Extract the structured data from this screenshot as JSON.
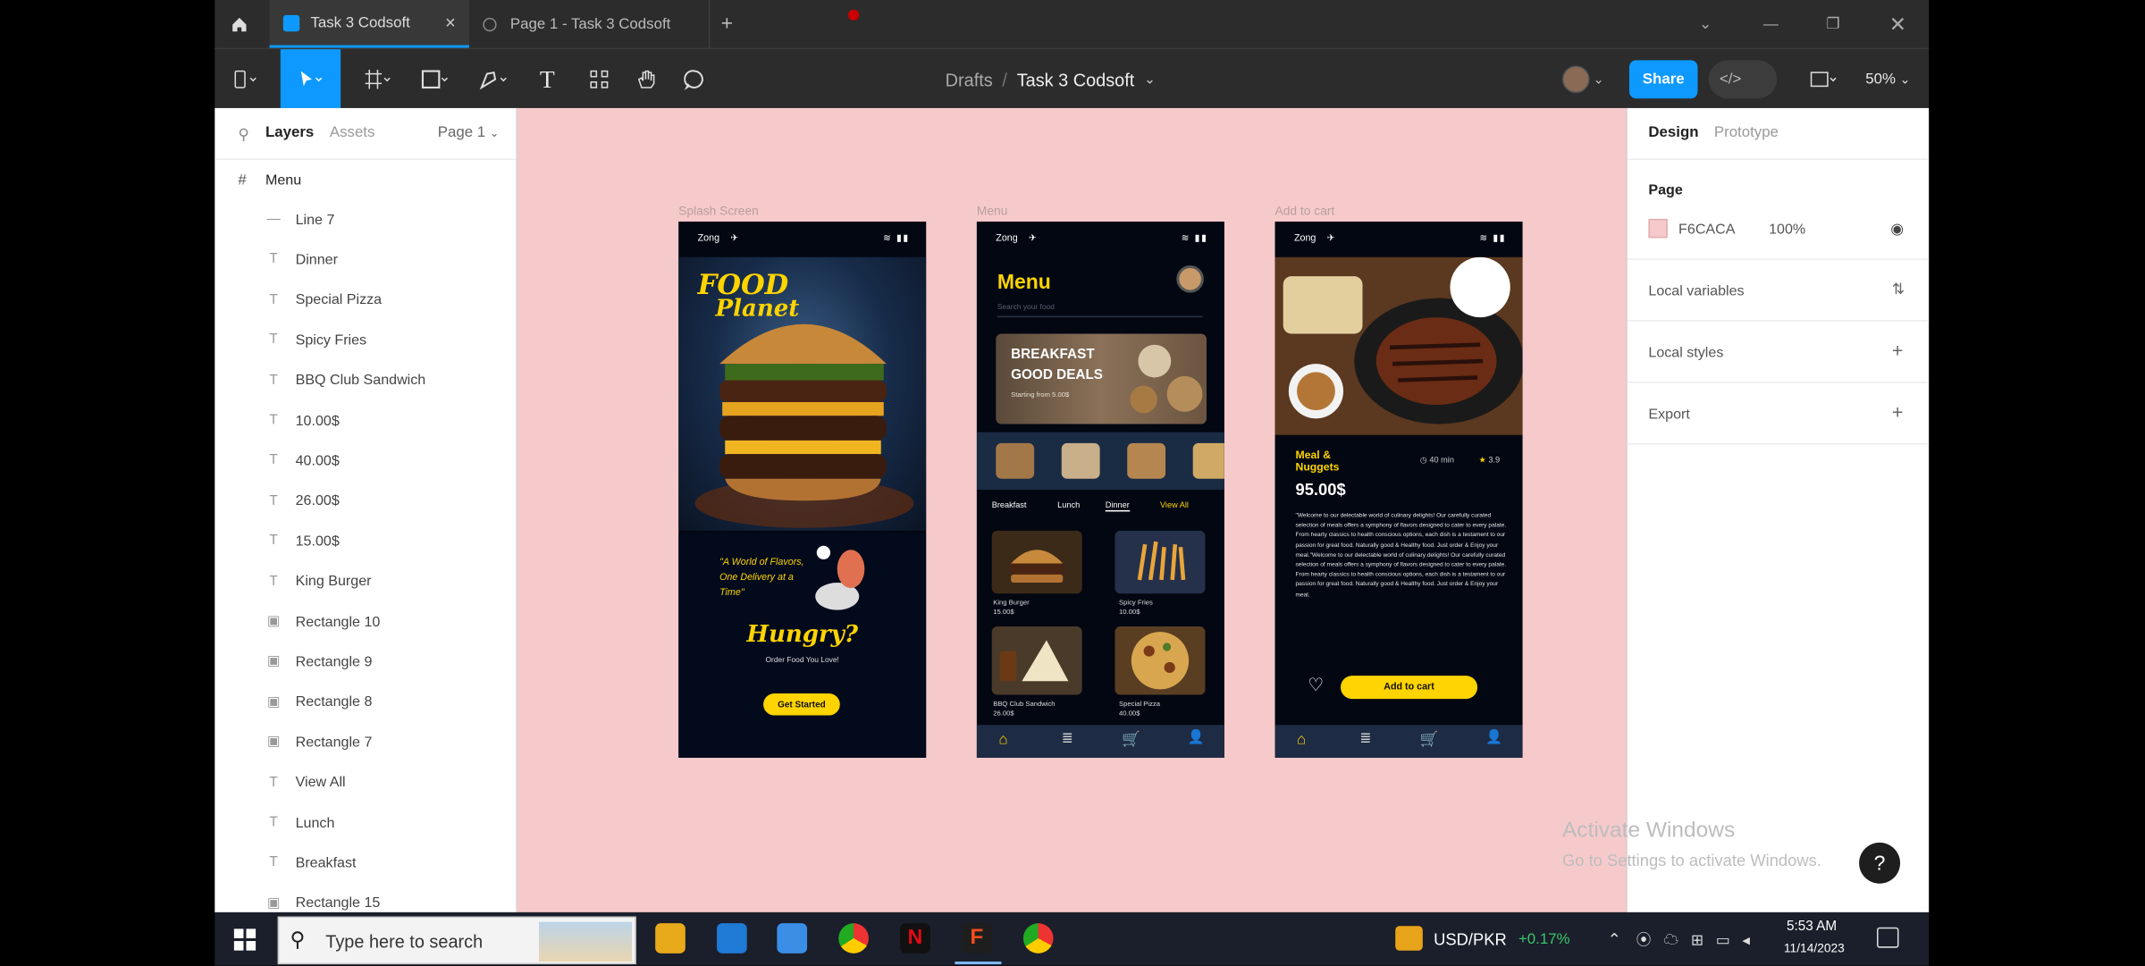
{
  "tabs": {
    "active": "Task 3 Codsoft",
    "second": "Page 1 - Task 3 Codsoft",
    "add": "+"
  },
  "toolbar": {
    "breadcrumb_root": "Drafts",
    "breadcrumb_sep": "/",
    "file_name": "Task 3 Codsoft",
    "share": "Share",
    "zoom": "50%"
  },
  "left_panel": {
    "tab_layers": "Layers",
    "tab_assets": "Assets",
    "page": "Page 1",
    "frame": "Menu",
    "layers": [
      {
        "icon": "line-icon",
        "label": "Line 7"
      },
      {
        "icon": "text-icon",
        "label": "Dinner"
      },
      {
        "icon": "text-icon",
        "label": "Special Pizza"
      },
      {
        "icon": "text-icon",
        "label": "Spicy Fries"
      },
      {
        "icon": "text-icon",
        "label": "BBQ Club Sandwich"
      },
      {
        "icon": "text-icon",
        "label": "10.00$"
      },
      {
        "icon": "text-icon",
        "label": "40.00$"
      },
      {
        "icon": "text-icon",
        "label": "26.00$"
      },
      {
        "icon": "text-icon",
        "label": "15.00$"
      },
      {
        "icon": "text-icon",
        "label": "King Burger"
      },
      {
        "icon": "image-icon",
        "label": "Rectangle 10"
      },
      {
        "icon": "image-icon",
        "label": "Rectangle 9"
      },
      {
        "icon": "image-icon",
        "label": "Rectangle 8"
      },
      {
        "icon": "image-icon",
        "label": "Rectangle 7"
      },
      {
        "icon": "text-icon",
        "label": "View All"
      },
      {
        "icon": "text-icon",
        "label": "Lunch"
      },
      {
        "icon": "text-icon",
        "label": "Breakfast"
      },
      {
        "icon": "image-icon",
        "label": "Rectangle 15"
      }
    ]
  },
  "right_panel": {
    "tab_design": "Design",
    "tab_prototype": "Prototype",
    "page_label": "Page",
    "page_color": "F6CACA",
    "page_opacity": "100%",
    "local_variables": "Local variables",
    "local_styles": "Local styles",
    "export": "Export"
  },
  "canvas": {
    "bg_color": "#f6cacb",
    "frame_labels": {
      "splash": "Splash Screen",
      "menu": "Menu",
      "cart": "Add to cart"
    }
  },
  "status": {
    "carrier": "Zong"
  },
  "splash": {
    "title_1": "FOOD",
    "title_2": "Planet",
    "quote": "\"A World of Flavors, One Delivery at a Time\"",
    "hungry": "Hungry?",
    "sub": "Order Food You Love!",
    "cta": "Get Started"
  },
  "menu": {
    "title": "Menu",
    "search": "Search your food",
    "banner_1": "BREAKFAST",
    "banner_2": "GOOD DEALS",
    "banner_sub": "Starting from 5.00$",
    "cats": {
      "breakfast": "Breakfast",
      "lunch": "Lunch",
      "dinner": "Dinner",
      "view_all": "View All"
    },
    "items": [
      {
        "name": "King Burger",
        "price": "15.00$"
      },
      {
        "name": "Spicy Fries",
        "price": "10.00$"
      },
      {
        "name": "BBQ Club Sandwich",
        "price": "26.00$"
      },
      {
        "name": "Special Pizza",
        "price": "40.00$"
      }
    ]
  },
  "cart": {
    "title_1": "Meal &",
    "title_2": "Nuggets",
    "price": "95.00$",
    "time": "40 min",
    "rating": "3.9",
    "desc": "\"Welcome to our delectable world of culinary delights! Our carefully curated selection of meals offers a symphony of flavors designed to cater to every palate. From hearty classics to health conscious options, each dish is a testament to our passion for great food. Naturally good & Healthy food. Just order & Enjoy your meal.\"Welcome to our delectable world of culinary delights! Our carefully curated selection of meals offers a symphony of flavors designed to cater to every palate. From hearty classics to health conscious options, each dish is a testament to our passion for great food. Naturally good & Healthy food. Just order & Enjoy your meal.",
    "add_btn": "Add to cart"
  },
  "watermark": {
    "line1": "Activate Windows",
    "line2": "Go to Settings to activate Windows."
  },
  "taskbar": {
    "search": "Type here to search",
    "ticker": "USD/PKR",
    "change": "+0.17%",
    "time": "5:53 AM",
    "date": "11/14/2023"
  },
  "colors": {
    "accent": "#0d99ff",
    "yellow": "#ffd400",
    "dark": "#2c2c2c"
  }
}
